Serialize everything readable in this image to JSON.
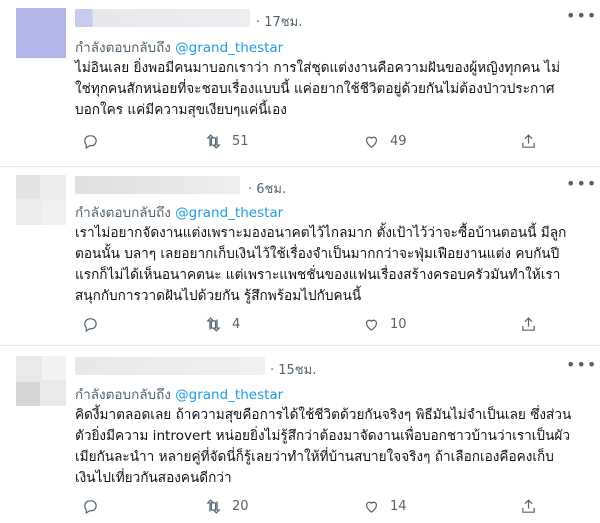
{
  "tweets": [
    {
      "time": "· 17ชม.",
      "reply_prefix": "กำลังตอบกลับถึง",
      "reply_handle": "@grand_thestar",
      "body": [
        "ไม่อินเลย ยิ่งพอมีคนมาบอกเราว่า การใส่ชุดแต่งงานคือความฝันของผู้หญิงทุกคน ไม่",
        "ใช่ทุกคนสักหน่อยที่จะชอบเรื่องแบบนี้ แค่อยากใช้ชีวิตอยู่ด้วยกันไม่ต้องป่าวประกาศ",
        "บอกใคร แค่มีความสุขเงียบๆแค่นี้เอง"
      ],
      "retweets": "51",
      "likes": "49"
    },
    {
      "time": "· 6ชม.",
      "reply_prefix": "กำลังตอบกลับถึง",
      "reply_handle": "@grand_thestar",
      "body": [
        "เราไม่อยากจัดงานแต่งเพราะมองอนาคตไว้ไกลมาก ตั้งเป้าไว้ว่าจะซื้อบ้านตอนนี้ มีลูก",
        "ตอนนั้น บลาๆ เลยอยากเก็บเงินไว้ใช้เรื่องจำเป็นมากกว่าจะฟุ่มเฟือยงานแต่ง คบกันปี",
        "แรกก็ไม่ได้เห็นอนาคตนะ แต่เพราะแพชชั่นของแฟนเรื่องสร้างครอบครัวมันทำให้เรา",
        "สนุกกับการวาดฝันไปด้วยกัน รู้สึกพร้อมไปกับคนนี้"
      ],
      "retweets": "4",
      "likes": "10"
    },
    {
      "time": "· 15ชม.",
      "reply_prefix": "กำลังตอบกลับถึง",
      "reply_handle": "@grand_thestar",
      "body": [
        "คิดงี้มาตลอดเลย ถ้าความสุขคือการได้ใช้ชีวิตด้วยกันจริงๆ พิธีมันไม่จำเป็นเลย ซึ่งส่วน",
        "ตัวยิ่งมีความ introvert หน่อยยิ่งไม่รู้สึกว่าต้องมาจัดงานเพื่อบอกชาวบ้านว่าเราเป็นผัว",
        "เมียกันละนำา หลายคู่ที่จัดนี่ก็รู้เลยว่าทำให้ที่บ้านสบายใจจริงๆ ถ้าเลือกเองคือคงเก็บ",
        "เงินไปเที่ยวกันสองคนดีกว่า"
      ],
      "retweets": "20",
      "likes": "14"
    }
  ],
  "icons": {
    "reply": "comment-icon",
    "retweet": "retweet-icon",
    "like": "heart-icon",
    "share": "share-icon",
    "more": "more-icon"
  },
  "colors": {
    "link": "#1d9bf0",
    "muted": "#536471",
    "divider": "#e6ecf0"
  }
}
